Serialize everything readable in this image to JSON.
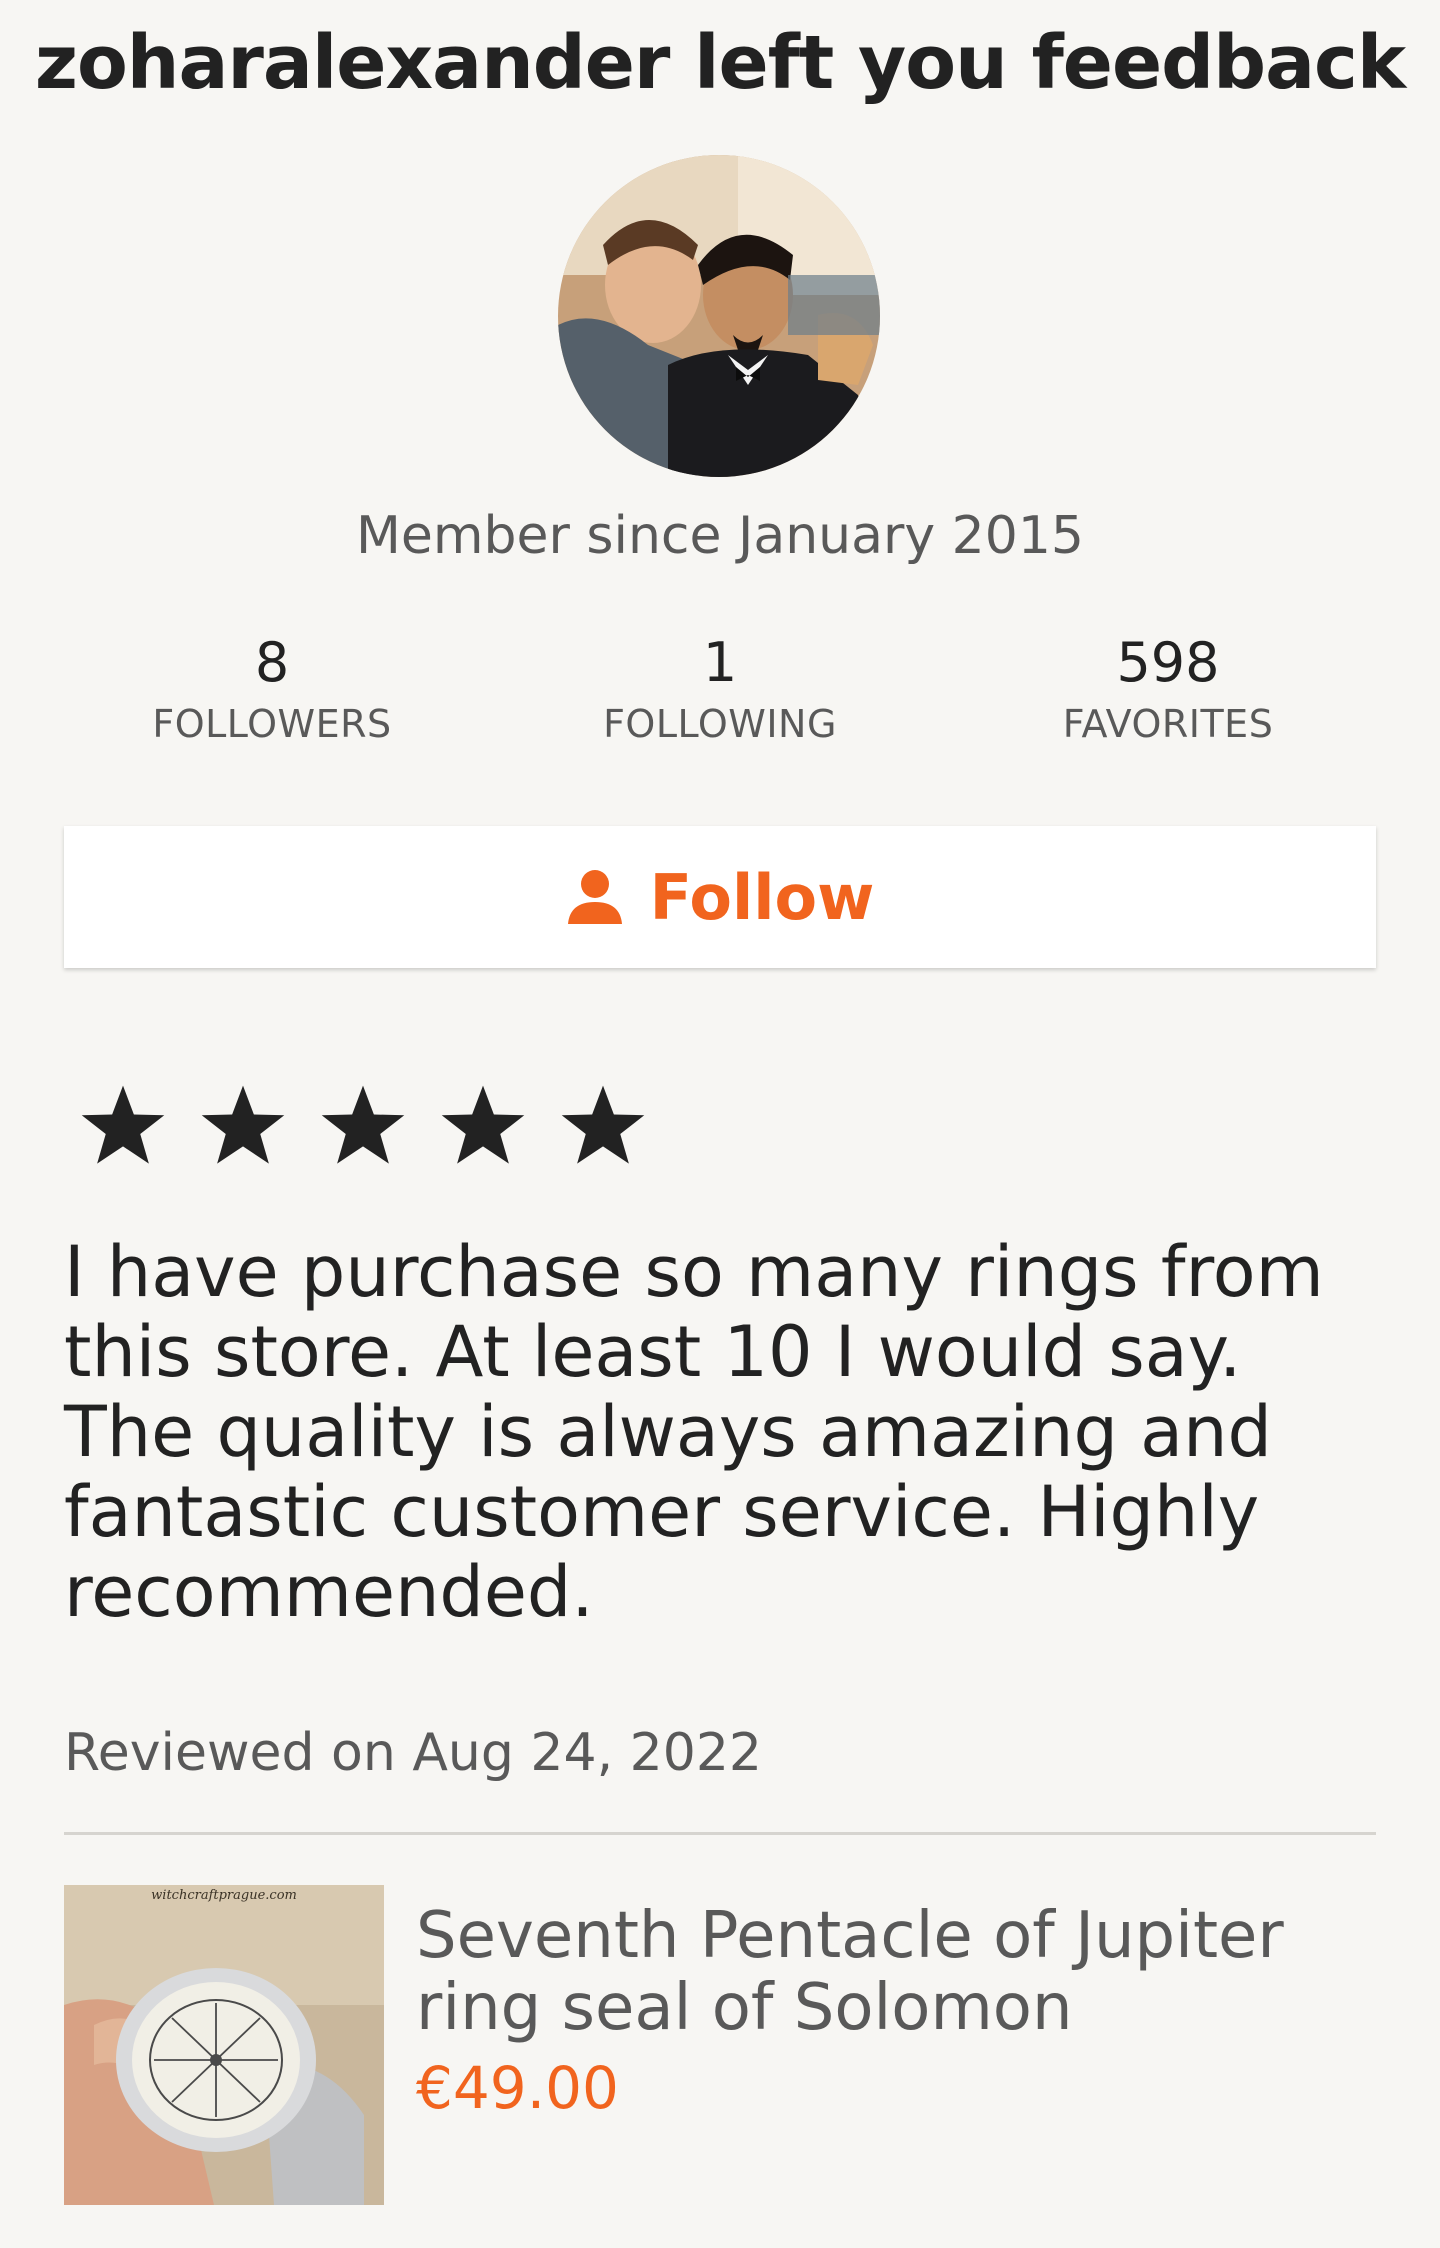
{
  "header": {
    "title": "zoharalexander left you feedback"
  },
  "profile": {
    "avatar_alt": "zoharalexander",
    "member_since": "Member since January 2015",
    "stats": [
      {
        "value": "8",
        "label": "FOLLOWERS"
      },
      {
        "value": "1",
        "label": "FOLLOWING"
      },
      {
        "value": "598",
        "label": "FAVORITES"
      }
    ],
    "follow_label": "Follow",
    "follow_icon": "user-icon"
  },
  "review": {
    "rating": 5,
    "rating_max": 5,
    "text": "I have purchase so many rings from this store. At least 10 I would say. The quality is always amazing and fantastic customer service. Highly recommended.",
    "date": "Reviewed on Aug 24, 2022"
  },
  "product": {
    "image_watermark": "witchcraftprague.com",
    "title": "Seventh Pentacle of Jupiter ring seal of Solomon",
    "price": "€49.00"
  },
  "colors": {
    "accent": "#f1641e",
    "text": "#222222",
    "muted": "#595959",
    "background": "#f7f6f3"
  }
}
